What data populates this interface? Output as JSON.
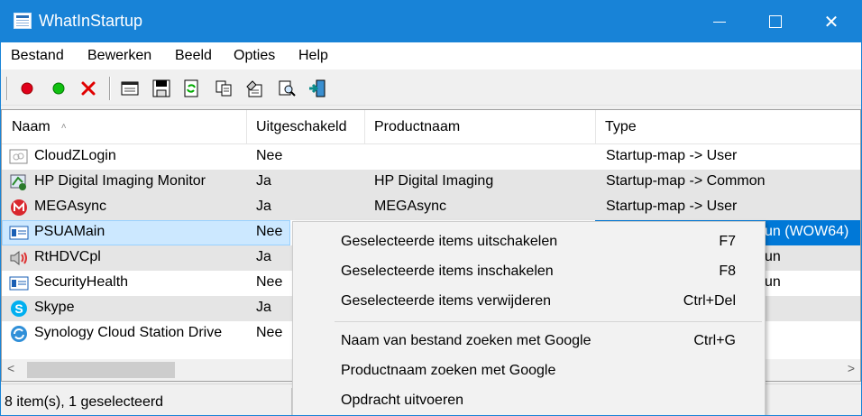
{
  "window": {
    "title": "WhatInStartup",
    "minimize_icon": "minimize-icon",
    "maximize_icon": "maximize-icon",
    "close_label": "✕"
  },
  "menu": [
    "Bestand",
    "Bewerken",
    "Beeld",
    "Opties",
    "Help"
  ],
  "toolbar": {
    "icons": [
      "disable-red-dot-icon",
      "enable-green-dot-icon",
      "delete-red-x-icon",
      "properties-window-icon",
      "save-floppy-icon",
      "refresh-icon",
      "copy-icon",
      "options-icon",
      "find-icon",
      "exit-icon"
    ],
    "colors": {
      "red": "#e0001b",
      "green": "#00c000",
      "delete": "#e00000"
    }
  },
  "table": {
    "columns": [
      "Naam",
      "Uitgeschakeld",
      "Productnaam",
      "Type"
    ],
    "sort_indicator": "˄",
    "rows": [
      {
        "icon": "generic-app-icon",
        "name": "CloudZLogin",
        "disabled": "Nee",
        "product": "",
        "type": "Startup-map -> User"
      },
      {
        "icon": "hp-imaging-icon",
        "name": "HP Digital Imaging Monitor",
        "disabled": "Ja",
        "product": "HP Digital Imaging",
        "type": "Startup-map -> Common"
      },
      {
        "icon": "mega-icon",
        "name": "MEGAsync",
        "disabled": "Ja",
        "product": "MEGAsync",
        "type": "Startup-map -> User"
      },
      {
        "icon": "window-app-icon",
        "name": "PSUAMain",
        "disabled": "Nee",
        "product": "",
        "type": "un (WOW64)"
      },
      {
        "icon": "speaker-icon",
        "name": "RtHDVCpl",
        "disabled": "Ja",
        "product": "",
        "type": "un"
      },
      {
        "icon": "security-health-icon",
        "name": "SecurityHealth",
        "disabled": "Nee",
        "product": "",
        "type": "un"
      },
      {
        "icon": "skype-icon",
        "name": "Skype",
        "disabled": "Ja",
        "product": "",
        "type": ""
      },
      {
        "icon": "synology-icon",
        "name": "Synology Cloud Station Drive",
        "disabled": "Nee",
        "product": "",
        "type": ""
      }
    ]
  },
  "scrollbar": {
    "left": "<",
    "right": ">"
  },
  "status": "8 item(s), 1 geselecteerd",
  "context_menu": {
    "items": [
      {
        "label": "Geselecteerde items uitschakelen",
        "shortcut": "F7"
      },
      {
        "label": "Geselecteerde items inschakelen",
        "shortcut": "F8"
      },
      {
        "label": "Geselecteerde items verwijderen",
        "shortcut": "Ctrl+Del"
      },
      {
        "label": "Naam van bestand zoeken met Google",
        "shortcut": "Ctrl+G"
      },
      {
        "label": "Productnaam zoeken met Google",
        "shortcut": ""
      },
      {
        "label": "Opdracht uitvoeren",
        "shortcut": ""
      }
    ]
  },
  "colors": {
    "titlebar": "#1883d7",
    "selection": "#0078d7",
    "selection_light": "#cce8ff"
  }
}
